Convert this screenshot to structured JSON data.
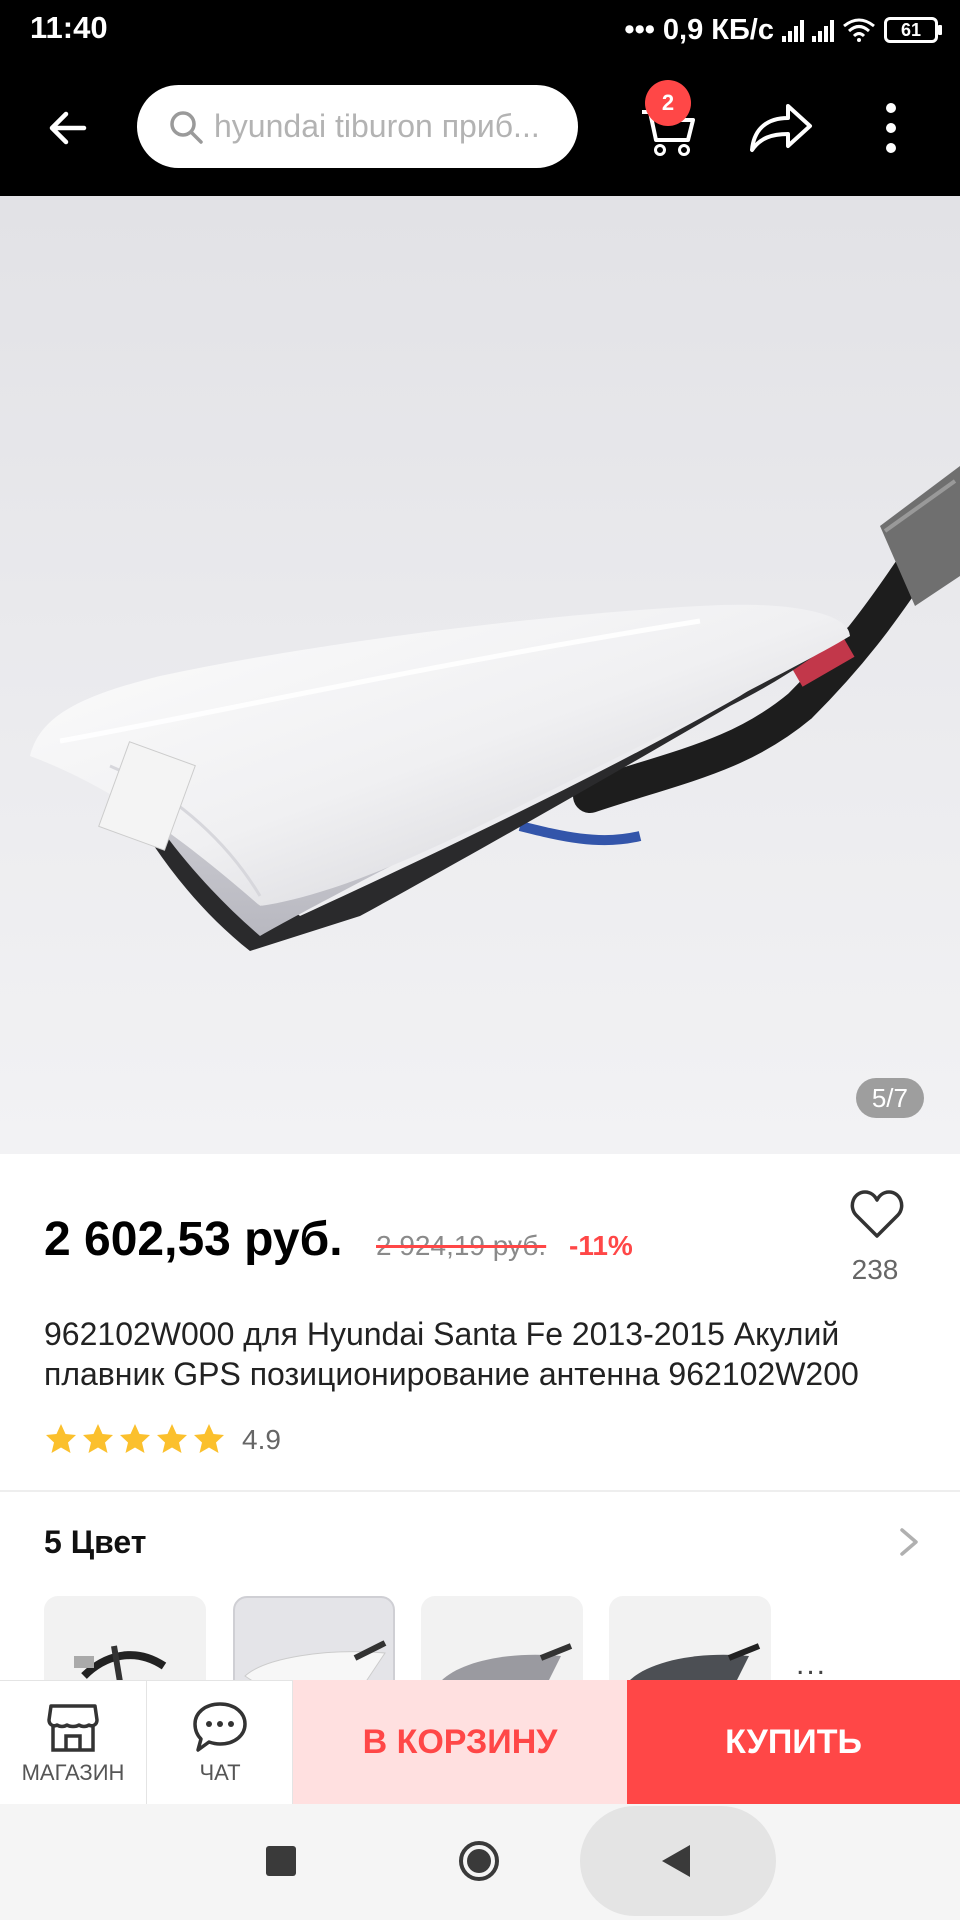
{
  "status_bar": {
    "time": "11:40",
    "network_speed": "0,9 КБ/с",
    "battery": "61"
  },
  "header": {
    "search_text": "hyundai tiburon приб...",
    "cart_count": "2",
    "icons": [
      "back-arrow-icon",
      "search-icon",
      "cart-icon",
      "share-icon",
      "more-icon"
    ]
  },
  "gallery": {
    "counter": "5/7"
  },
  "product": {
    "price": "2 602,53 руб.",
    "old_price": "2 924,19 руб.",
    "discount": "-11%",
    "wishlist_count": "238",
    "title": "962102W000 для Hyundai Santa Fe 2013-2015 Акулий плавник GPS позиционирование антенна 962102W200",
    "rating": "4.9",
    "stars": 5
  },
  "colors": {
    "heading": "5 Цвет",
    "more": "..."
  },
  "action_bar": {
    "store_label": "МАГАЗИН",
    "chat_label": "ЧАТ",
    "add_to_cart_label": "В КОРЗИНУ",
    "buy_label": "КУПИТЬ"
  },
  "theme": {
    "accent": "#ff4747",
    "accent_light": "#ffe0e0",
    "star": "#fbc02d"
  }
}
